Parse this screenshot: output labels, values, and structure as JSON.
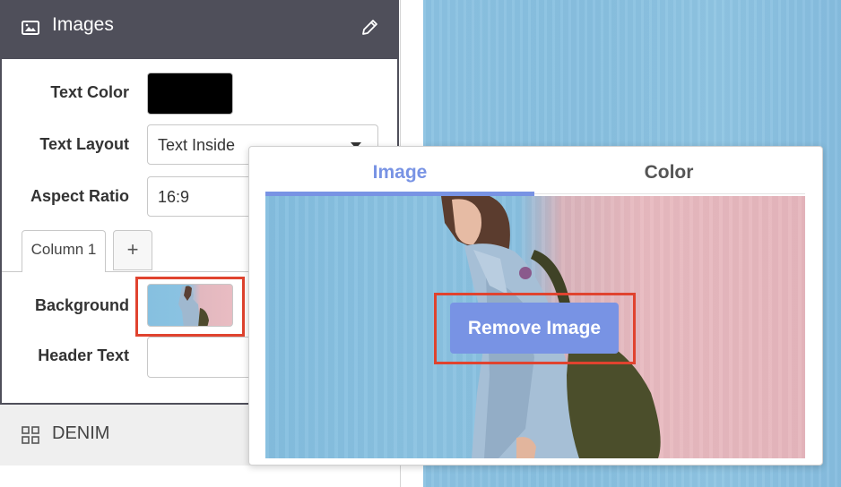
{
  "panel": {
    "title": "Images",
    "icons": {
      "header": "image-icon",
      "edit": "pencil-icon",
      "footer": "grid-icon"
    }
  },
  "fields": {
    "text_color_label": "Text Color",
    "text_color_value": "#000000",
    "text_layout_label": "Text Layout",
    "text_layout_value": "Text Inside",
    "aspect_ratio_label": "Aspect Ratio",
    "aspect_ratio_value": "16:9",
    "background_label": "Background",
    "header_text_label": "Header Text",
    "header_text_value": ""
  },
  "columns": {
    "tabs": [
      {
        "label": "Column 1"
      }
    ],
    "add_label": "+"
  },
  "footer": {
    "name": "DENIM"
  },
  "popover": {
    "tabs": [
      {
        "label": "Image"
      },
      {
        "label": "Color"
      }
    ],
    "active_tab": "Image",
    "remove_label": "Remove Image"
  },
  "colors": {
    "accent": "#7893e4",
    "header_bg": "#4f4f5a",
    "highlight": "#e0432f"
  }
}
